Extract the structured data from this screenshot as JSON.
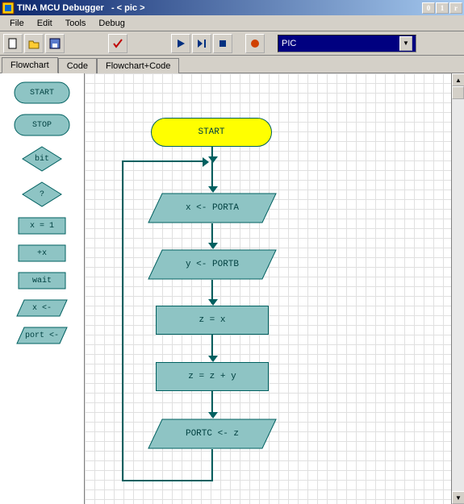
{
  "titlebar": {
    "app_name": "TINA MCU Debugger",
    "doc_label": "-  < pic >"
  },
  "window_buttons": {
    "minimize_glyph": "0",
    "maximize_glyph": "1",
    "close_glyph": "r"
  },
  "menubar": {
    "file": "File",
    "edit": "Edit",
    "tools": "Tools",
    "debug": "Debug"
  },
  "toolbar": {
    "chip_selected": "PIC"
  },
  "tabs": {
    "flowchart": "Flowchart",
    "code": "Code",
    "flowchart_code": "Flowchart+Code",
    "active": "Flowchart"
  },
  "palette": {
    "start": "START",
    "stop": "STOP",
    "bit": "bit",
    "question": "?",
    "assign": "x = 1",
    "inc": "+x",
    "wait": "wait",
    "input": "x <-",
    "output": "port <-"
  },
  "flowchart": {
    "nodes": {
      "start": {
        "label": "START"
      },
      "n1": {
        "label": "x <- PORTA"
      },
      "n2": {
        "label": "y <- PORTB"
      },
      "n3": {
        "label": "z = x"
      },
      "n4": {
        "label": "z = z + y"
      },
      "n5": {
        "label": "PORTC <- z"
      }
    }
  },
  "colors": {
    "node_fill": "#8ec4c4",
    "node_border": "#006060",
    "start_fill": "#ffff00",
    "select_bg": "#000080"
  }
}
